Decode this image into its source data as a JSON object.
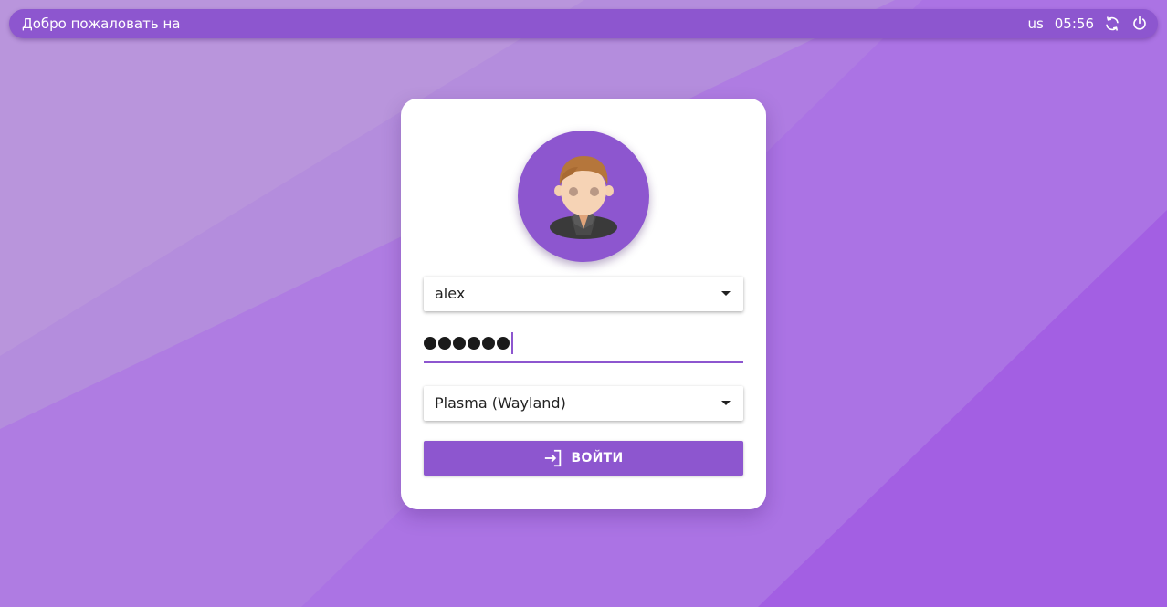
{
  "topbar": {
    "welcome_text": "Добро пожаловать на",
    "keyboard_layout": "us",
    "clock": "05:56",
    "icons": [
      "restart-icon",
      "power-icon"
    ]
  },
  "login": {
    "username": "alex",
    "password_mask": "●●●●●●",
    "session": "Plasma (Wayland)",
    "button_label": "ВОЙТИ"
  },
  "colors": {
    "accent": "#8d56cf",
    "background": "#ab78e2",
    "card": "#ffffff"
  }
}
